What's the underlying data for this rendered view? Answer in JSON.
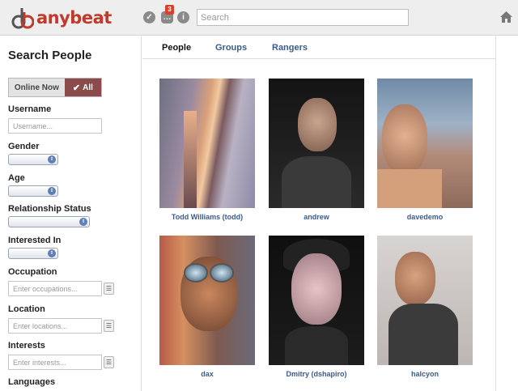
{
  "header": {
    "logo_text": "anybeat",
    "notification_count": "3",
    "search_placeholder": "Search"
  },
  "sidebar": {
    "title": "Search People",
    "toggle": {
      "online_label": "Online Now",
      "all_label": "All"
    },
    "labels": {
      "username": "Username",
      "gender": "Gender",
      "age": "Age",
      "relationship": "Relationship Status",
      "interested_in": "Interested In",
      "occupation": "Occupation",
      "location": "Location",
      "interests": "Interests",
      "languages": "Languages"
    },
    "placeholders": {
      "username": "Username...",
      "occupation": "Enter occupations...",
      "location": "Enter locations...",
      "interests": "Enter interests..."
    }
  },
  "tabs": [
    {
      "label": "People"
    },
    {
      "label": "Groups"
    },
    {
      "label": "Rangers"
    }
  ],
  "people": [
    {
      "name": "Todd Williams (todd)"
    },
    {
      "name": "andrew"
    },
    {
      "name": "davedemo"
    },
    {
      "name": "dax"
    },
    {
      "name": "Dmitry (dshapiro)"
    },
    {
      "name": "halcyon"
    }
  ],
  "colors": {
    "brand": "#c0392b",
    "link": "#3a5c8c",
    "toggle_active": "#8b4b4b",
    "header_bg": "#eeeeee"
  },
  "icons": [
    "anybeat-logo-icon",
    "check-circle-icon",
    "chat-bubble-icon",
    "info-icon",
    "home-icon",
    "check-icon",
    "select-arrows-icon",
    "add-list-icon"
  ]
}
